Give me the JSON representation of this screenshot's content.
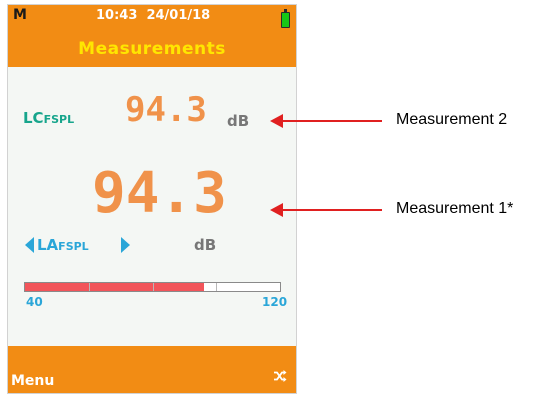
{
  "status_bar": {
    "mode": "M",
    "time": "10:43",
    "date": "24/01/18",
    "battery_icon": "battery-full-icon",
    "battery_color": "#16c816"
  },
  "header": {
    "title": "Measurements"
  },
  "measurement_2": {
    "label": "LC",
    "label_suffix": "F",
    "label_sub": "SPL",
    "value": "94.3",
    "unit": "dB"
  },
  "measurement_1": {
    "label": "LA",
    "label_suffix": "F",
    "label_sub": "SPL",
    "value": "94.3",
    "unit": "dB",
    "prev_icon": "triangle-left-icon",
    "next_icon": "triangle-right-icon"
  },
  "level_bar": {
    "min": "40",
    "max": "120",
    "level_fraction": 0.7
  },
  "footer": {
    "menu": "Menu",
    "action_icon": "shuffle-icon"
  },
  "annotations": [
    {
      "text": "Measurement 2"
    },
    {
      "text": "Measurement 1*"
    }
  ],
  "colors": {
    "accent": "#f28c14",
    "title": "#ffe600",
    "value": "#f0924a",
    "label_teal": "#17a58c",
    "label_blue": "#2aa6d8",
    "bar_fill": "#f2555a",
    "arrow": "#e02020"
  }
}
